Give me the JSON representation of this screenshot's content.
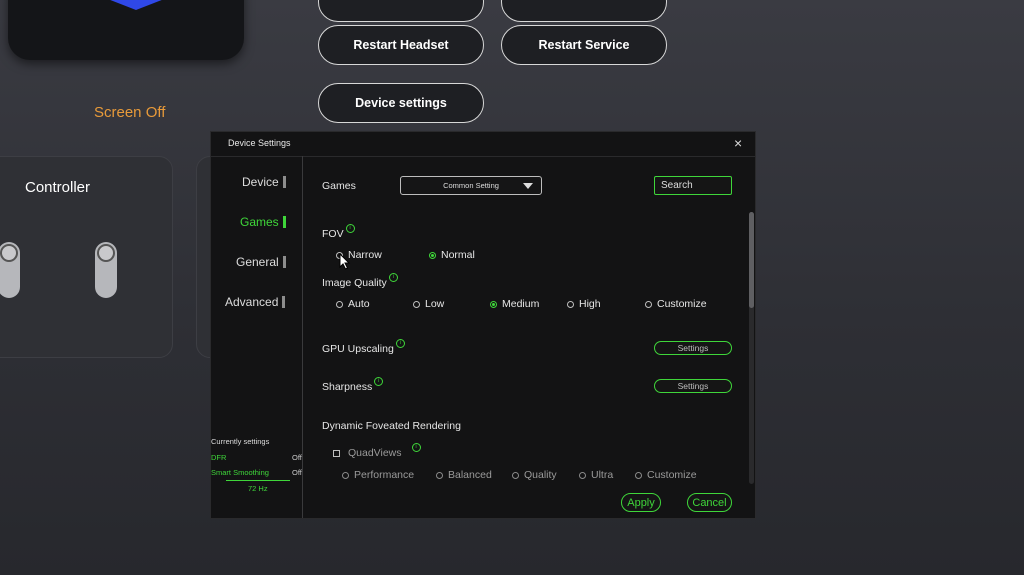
{
  "background": {
    "screen_status": "Screen Off",
    "buttons": {
      "restart_headset": "Restart Headset",
      "restart_service": "Restart Service",
      "device_settings": "Device settings"
    },
    "controller_card": {
      "title": "Controller"
    }
  },
  "dialog": {
    "title": "Device Settings",
    "close": "×",
    "nav": [
      "Device",
      "Games",
      "General",
      "Advanced"
    ],
    "active_nav": "Games",
    "current": {
      "label": "Currently settings",
      "dfr_label": "DFR",
      "dfr_value": "Off",
      "smooth_label": "Smart Smoothing",
      "smooth_value": "Off",
      "hz": "72 Hz"
    },
    "games_label": "Games",
    "games_select_value": "Common Setting",
    "search_label": "Search",
    "fov": {
      "label": "FOV",
      "options": [
        "Narrow",
        "Normal"
      ],
      "selected": "Normal"
    },
    "image_quality": {
      "label": "Image Quality",
      "options": [
        "Auto",
        "Low",
        "Medium",
        "High",
        "Customize"
      ],
      "selected": "Medium"
    },
    "gpu_upscaling": {
      "label": "GPU Upscaling",
      "button": "Settings"
    },
    "sharpness": {
      "label": "Sharpness",
      "button": "Settings"
    },
    "dfr": {
      "label": "Dynamic Foveated Rendering",
      "quadviews": "QuadViews",
      "options": [
        "Performance",
        "Balanced",
        "Quality",
        "Ultra",
        "Customize"
      ]
    },
    "apply": "Apply",
    "cancel": "Cancel"
  },
  "colors": {
    "accent": "#3fd63a",
    "warning": "#e89a3a"
  },
  "icons": {
    "close": "close-icon",
    "dropdown": "chevron-down-icon",
    "info": "info-icon",
    "cursor": "mouse-cursor-icon"
  }
}
